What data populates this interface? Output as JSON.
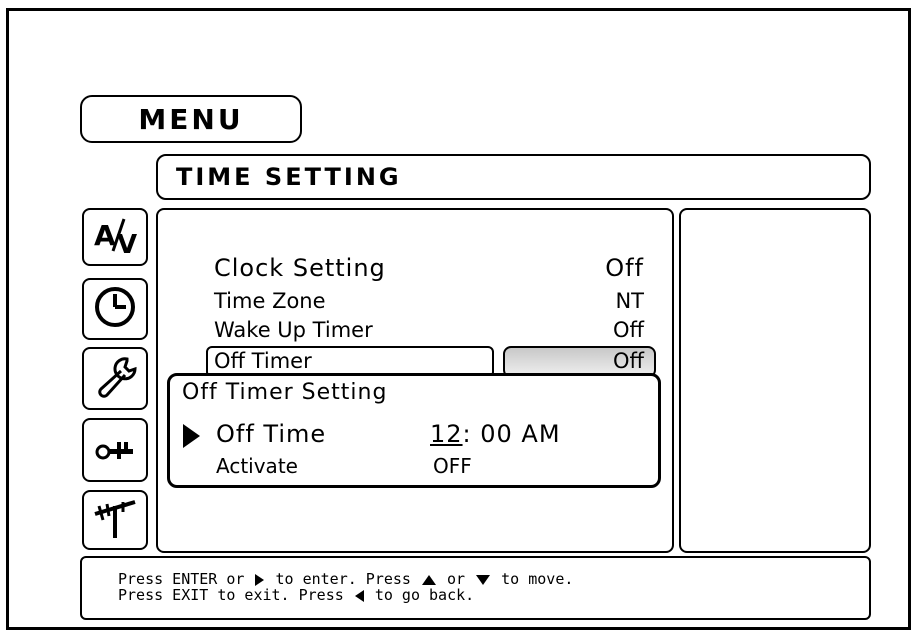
{
  "menu": {
    "title": "MENU"
  },
  "section": {
    "title": "TIME SETTING"
  },
  "sidebar": {
    "icons": [
      {
        "name": "av-icon",
        "glyph": "A/V"
      },
      {
        "name": "clock-icon"
      },
      {
        "name": "wrench-icon"
      },
      {
        "name": "key-icon"
      },
      {
        "name": "antenna-icon"
      }
    ]
  },
  "settings": {
    "rows": [
      {
        "label": "Clock Setting",
        "value": "Off"
      },
      {
        "label": "Time Zone",
        "value": "NT"
      },
      {
        "label": "Wake Up Timer",
        "value": "Off"
      },
      {
        "label": "Off Timer",
        "value": "Off"
      }
    ]
  },
  "popup": {
    "title": "Off Timer Setting",
    "off_time_label": "Off Time",
    "off_time_hour": "12",
    "off_time_rest": ": 00  AM",
    "activate_label": "Activate",
    "activate_value": "OFF"
  },
  "help": {
    "line1_a": "Press ENTER or ",
    "line1_b": " to enter. Press ",
    "line1_c": " or ",
    "line1_d": " to move.",
    "line2_a": "Press EXIT to exit. Press ",
    "line2_b": " to go back."
  }
}
